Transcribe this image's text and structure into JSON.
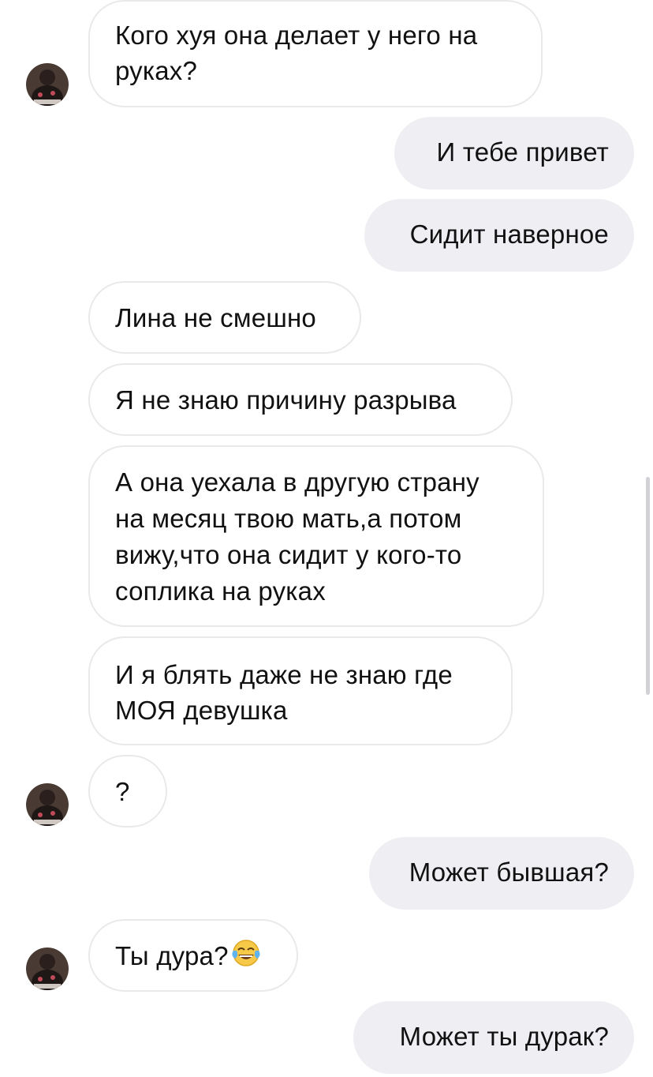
{
  "messages": [
    {
      "text": "Кого хуя она делает у него на\nруках?"
    },
    {
      "text": "И тебе привет"
    },
    {
      "text": "Сидит наверное"
    },
    {
      "text": "Лина не смешно"
    },
    {
      "text": "Я не знаю причину разрыва"
    },
    {
      "text": "А она уехала в другую страну\nна месяц твою мать,а потом\nвижу,что она сидит у кого-то\nсоплика на руках"
    },
    {
      "text": "И я блять даже не знаю где\nМОЯ девушка"
    },
    {
      "text": "?"
    },
    {
      "text": "Может бывшая?"
    },
    {
      "text": "Ты дура?",
      "emoji": "tears-of-joy-emoji"
    },
    {
      "text": "Может ты дурак?"
    }
  ],
  "colors": {
    "incoming_bubble": "#ffffff",
    "incoming_border": "#e9e9ec",
    "outgoing_bubble": "#efeef2",
    "text": "#111111"
  }
}
